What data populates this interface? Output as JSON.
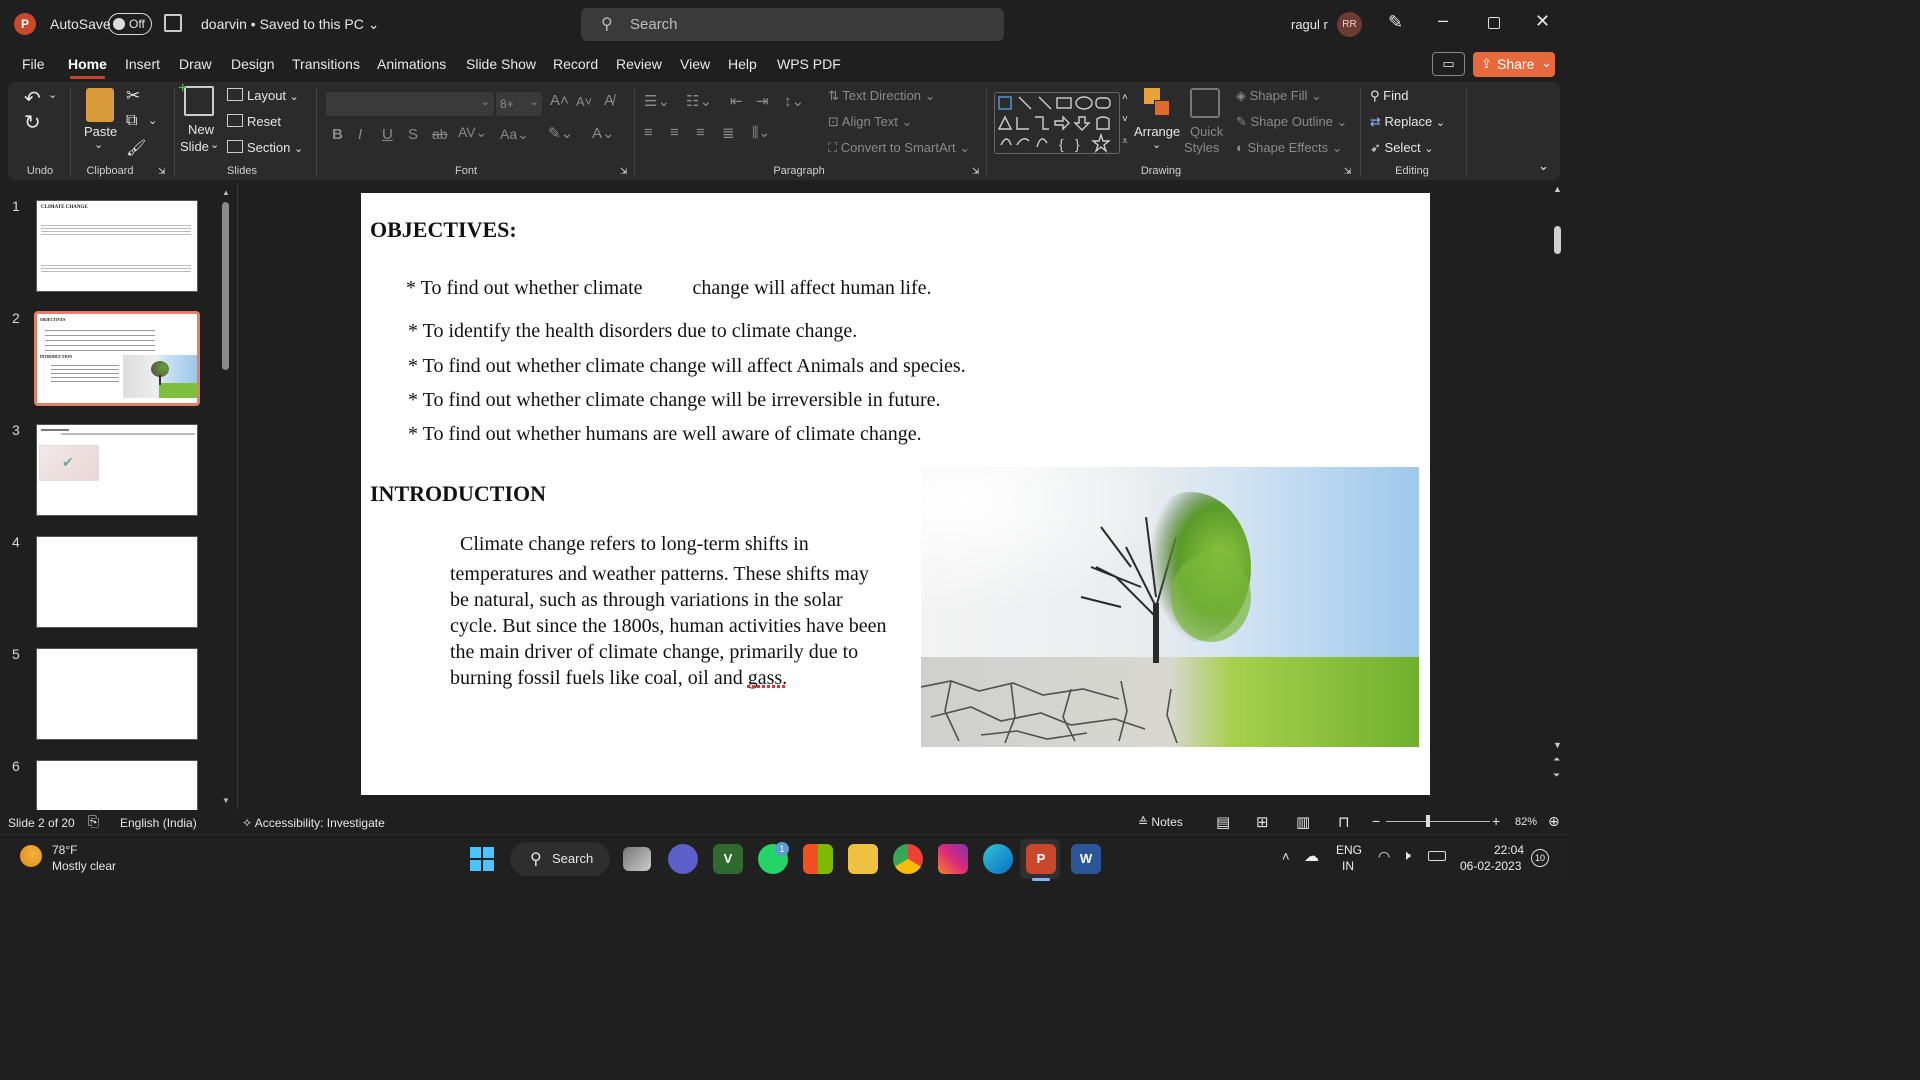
{
  "titlebar": {
    "app_letter": "P",
    "autosave_label": "AutoSave",
    "autosave_state": "Off",
    "doc_title": "doarvin • Saved to this PC",
    "search_placeholder": "Search",
    "user_name": "ragul r",
    "user_initials": "RR"
  },
  "tabs": [
    "File",
    "Home",
    "Insert",
    "Draw",
    "Design",
    "Transitions",
    "Animations",
    "Slide Show",
    "Record",
    "Review",
    "View",
    "Help",
    "WPS PDF"
  ],
  "share_label": "Share",
  "ribbon": {
    "groups": {
      "undo": "Undo",
      "clipboard": "Clipboard",
      "slides": "Slides",
      "font": "Font",
      "paragraph": "Paragraph",
      "drawing": "Drawing",
      "editing": "Editing"
    },
    "paste": "Paste",
    "new_slide_1": "New",
    "new_slide_2": "Slide",
    "layout": "Layout",
    "reset": "Reset",
    "section": "Section",
    "font_size": "8+",
    "text_direction": "Text Direction",
    "align_text": "Align Text",
    "convert_smartart": "Convert to SmartArt",
    "arrange": "Arrange",
    "quick_styles_1": "Quick",
    "quick_styles_2": "Styles",
    "shape_fill": "Shape Fill",
    "shape_outline": "Shape Outline",
    "shape_effects": "Shape Effects",
    "find": "Find",
    "replace": "Replace",
    "select": "Select"
  },
  "thumbnails": [
    "1",
    "2",
    "3",
    "4",
    "5",
    "6"
  ],
  "thumbnail_texts": {
    "t1_title": "CLIMATE CHANGE",
    "t2_title": "OBJECTIVES",
    "t2_intro": "INTRODUCTION"
  },
  "slide": {
    "objectives_heading": "OBJECTIVES:",
    "bullets": [
      "* To find out whether climate          change will affect human life.",
      "* To identify the health disorders due to climate change.",
      "* To find out whether climate change will affect Animals and species.",
      "* To find out whether climate change will be irreversible in future.",
      "* To find out whether humans are well aware of climate change."
    ],
    "intro_heading": "INTRODUCTION",
    "intro_lines": [
      "  Climate change refers to long-term shifts in",
      "temperatures and weather patterns. These shifts may",
      "be natural, such as through variations in the solar",
      "cycle. But since the 1800s, human activities have been",
      "the main driver of climate change, primarily due to",
      "burning fossil fuels like coal, oil and gass."
    ]
  },
  "status": {
    "slide_count": "Slide 2 of 20",
    "language": "English (India)",
    "accessibility": "Accessibility: Investigate",
    "notes": "Notes",
    "zoom": "82%"
  },
  "taskbar": {
    "temp": "78°F",
    "weather": "Mostly clear",
    "search": "Search",
    "lang_1": "ENG",
    "lang_2": "IN",
    "time": "22:04",
    "date": "06-02-2023",
    "notif_count": "10",
    "whatsapp_badge": "1"
  },
  "colors": {
    "accent": "#c9472b",
    "share_button": "#e66a3d",
    "selected_thumb": "#e0806c"
  }
}
